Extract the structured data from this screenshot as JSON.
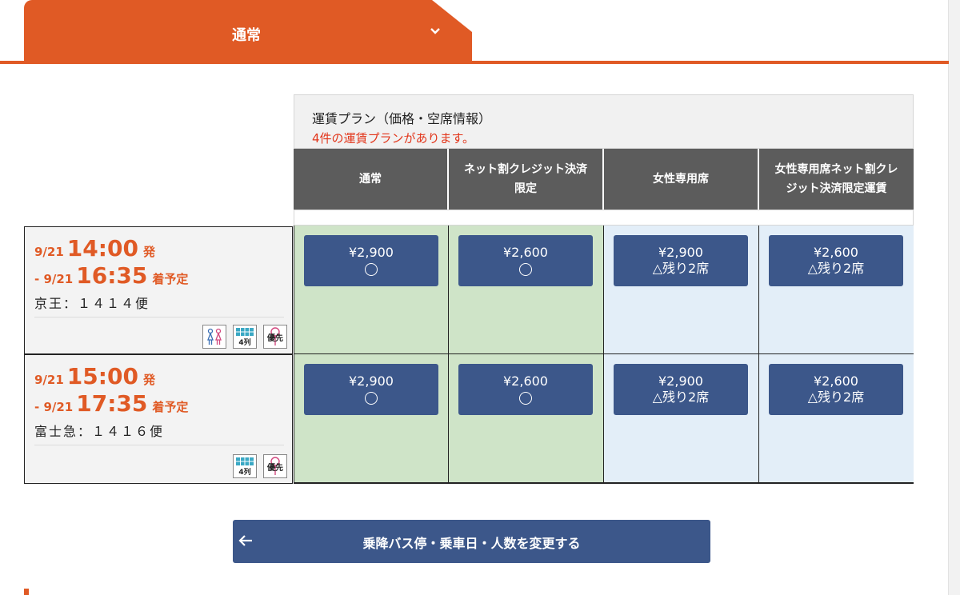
{
  "tab": {
    "label": "通常"
  },
  "fare_table": {
    "title": "運賃プラン（価格・空席情報）",
    "count_text": "4件の運賃プランがあります。",
    "columns": [
      {
        "line1": "通常",
        "line2": ""
      },
      {
        "line1": "ネット割クレジット決済",
        "line2": "限定"
      },
      {
        "line1": "女性専用席",
        "line2": ""
      },
      {
        "line1": "女性専用席ネット割クレ",
        "line2": "ジット決済限定運賃"
      }
    ]
  },
  "buses": [
    {
      "dep_date": "9/21",
      "dep_time": "14:00",
      "dep_suffix": "発",
      "arr_prefix": "- 9/21",
      "arr_time": "16:35",
      "arr_suffix": "着予定",
      "name": "京王：１４１４便",
      "icons": [
        "women-seat-icon",
        "4-row-seat-icon",
        "priority-seat-icon"
      ],
      "fares": [
        {
          "price": "¥2,900",
          "availability": "",
          "status": "circle"
        },
        {
          "price": "¥2,600",
          "availability": "",
          "status": "circle"
        },
        {
          "price": "¥2,900",
          "availability": "△残り2席",
          "status": "text"
        },
        {
          "price": "¥2,600",
          "availability": "△残り2席",
          "status": "text"
        }
      ]
    },
    {
      "dep_date": "9/21",
      "dep_time": "15:00",
      "dep_suffix": "発",
      "arr_prefix": "- 9/21",
      "arr_time": "17:35",
      "arr_suffix": "着予定",
      "name": "富士急：１４１６便",
      "icons": [
        "4-row-seat-icon",
        "priority-seat-icon"
      ],
      "fares": [
        {
          "price": "¥2,900",
          "availability": "",
          "status": "circle"
        },
        {
          "price": "¥2,600",
          "availability": "",
          "status": "circle"
        },
        {
          "price": "¥2,900",
          "availability": "△残り2席",
          "status": "text"
        },
        {
          "price": "¥2,600",
          "availability": "△残り2席",
          "status": "text"
        }
      ]
    }
  ],
  "icon_labels": {
    "four_row": "4列",
    "priority": "優先"
  },
  "back_button": {
    "label": "乗降バス停・乗車日・人数を変更する"
  },
  "colors": {
    "accent": "#e05a25",
    "button": "#3c578a",
    "green_cell": "#cfe4c8",
    "blue_cell": "#e3eef8",
    "alert": "#e2361b"
  }
}
